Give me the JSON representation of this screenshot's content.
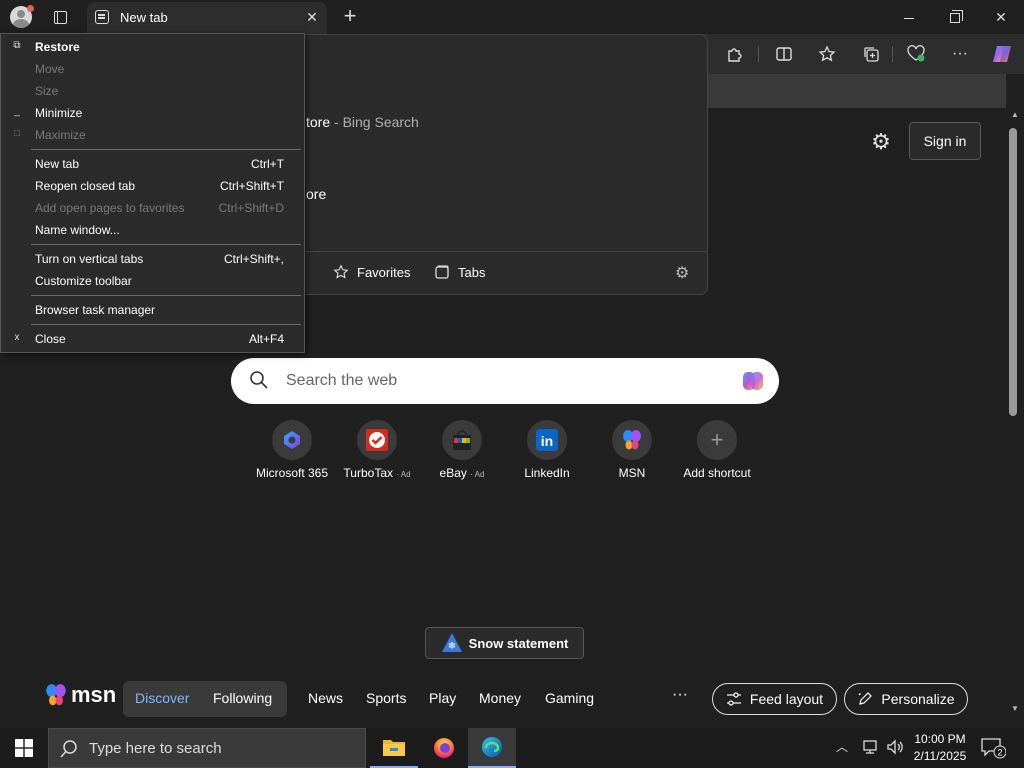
{
  "tab": {
    "title": "New tab"
  },
  "page": {
    "sign_in": "Sign in",
    "search_placeholder": "Search the web",
    "snow_label": "Snow statement",
    "shortcuts": [
      {
        "label": "Microsoft 365",
        "ad": ""
      },
      {
        "label": "TurboTax",
        "ad": "· Ad"
      },
      {
        "label": "eBay",
        "ad": "· Ad"
      },
      {
        "label": "LinkedIn",
        "ad": ""
      },
      {
        "label": "MSN",
        "ad": ""
      },
      {
        "label": "Add shortcut",
        "ad": ""
      }
    ]
  },
  "flyout": {
    "row1_text": "tore",
    "row1_suffix": " - Bing Search",
    "row2_text": "ore",
    "favorites": "Favorites",
    "tabs": "Tabs"
  },
  "msn": {
    "logo": "msn",
    "discover": "Discover",
    "following": "Following",
    "nav": [
      "News",
      "Sports",
      "Play",
      "Money",
      "Gaming"
    ],
    "more": "···",
    "feed_layout": "Feed layout",
    "personalize": "Personalize"
  },
  "menu": {
    "items": [
      {
        "label": "Restore",
        "accel": "",
        "glyph": "⧉"
      },
      {
        "label": "Move",
        "accel": "",
        "glyph": ""
      },
      {
        "label": "Size",
        "accel": "",
        "glyph": ""
      },
      {
        "label": "Minimize",
        "accel": "",
        "glyph": "_"
      },
      {
        "label": "Maximize",
        "accel": "",
        "glyph": "□"
      },
      {
        "label": "New tab",
        "accel": "Ctrl+T",
        "glyph": ""
      },
      {
        "label": "Reopen closed tab",
        "accel": "Ctrl+Shift+T",
        "glyph": ""
      },
      {
        "label": "Add open pages to favorites",
        "accel": "Ctrl+Shift+D",
        "glyph": ""
      },
      {
        "label": "Name window...",
        "accel": "",
        "glyph": ""
      },
      {
        "label": "Turn on vertical tabs",
        "accel": "Ctrl+Shift+,",
        "glyph": ""
      },
      {
        "label": "Customize toolbar",
        "accel": "",
        "glyph": ""
      },
      {
        "label": "Browser task manager",
        "accel": "",
        "glyph": ""
      },
      {
        "label": "Close",
        "accel": "Alt+F4",
        "glyph": "x"
      }
    ]
  },
  "taskbar": {
    "search_text": "Type here to search",
    "time": "10:00 PM",
    "date": "2/11/2025",
    "notification_count": "2"
  },
  "colors": {
    "accent": "#7cb8ff",
    "background": "#202020",
    "menu_bg": "#2b2b2b"
  }
}
